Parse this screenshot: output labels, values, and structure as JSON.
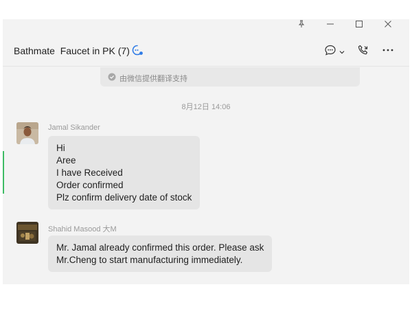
{
  "chat": {
    "title": "Bathmate  Faucet in PK (7)"
  },
  "notice": {
    "text": "由微信提供翻译支持"
  },
  "timestamp": "8月12日 14:06",
  "messages": [
    {
      "sender": "Jamal Sikander",
      "lines": [
        "Hi",
        "Aree",
        "I have Received",
        "Order confirmed",
        "Plz confirm delivery date of stock"
      ]
    },
    {
      "sender": "Shahid Masood 大M",
      "lines": [
        "Mr. Jamal already confirmed this order.  Please ask",
        "Mr.Cheng to start manufacturing immediately."
      ]
    }
  ],
  "icons": [
    "pin-icon",
    "minimize-icon",
    "maximize-icon",
    "close-icon",
    "chat-bubble-icon",
    "chevron-down-icon",
    "call-icon",
    "more-icon",
    "check-circle-icon"
  ],
  "colors": {
    "bubble": "#e5e5e5",
    "accent_blue": "#2f7be6",
    "green_marker": "#3dbb63"
  }
}
